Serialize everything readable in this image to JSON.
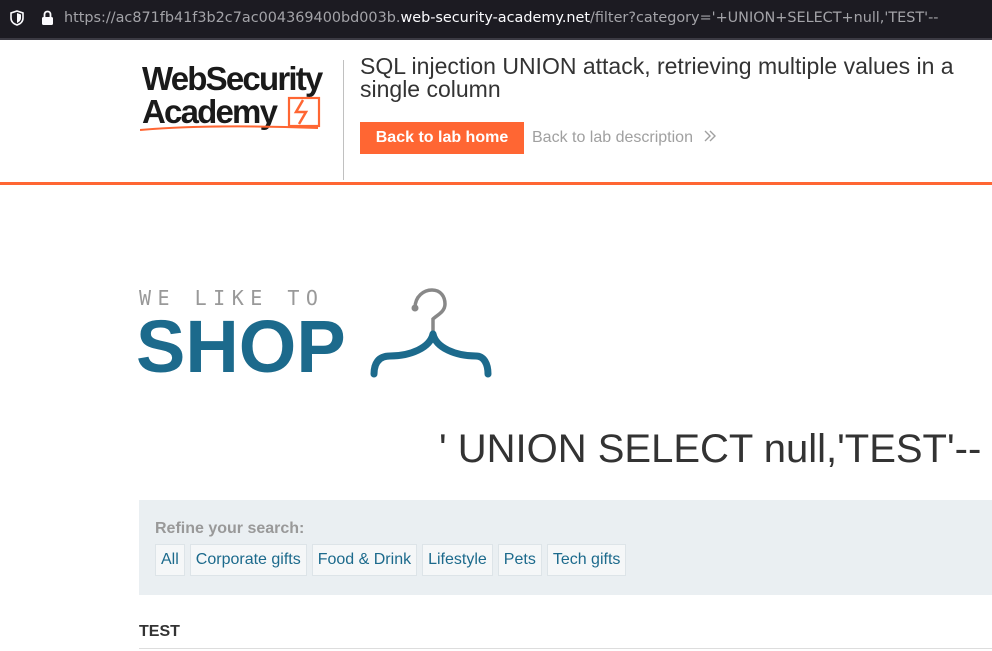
{
  "browser": {
    "url_prefix": "https://ac871fb41f3b2c7ac004369400bd003b.",
    "url_host": "web-security-academy.net",
    "url_path": "/filter?category='+UNION+SELECT+null,'TEST'--"
  },
  "lab_header": {
    "logo_line1": "WebSecurity",
    "logo_line2": "Academy",
    "title": "SQL injection UNION attack, retrieving multiple values in a single column",
    "back_home_label": "Back to lab home",
    "back_description_label": "Back to lab description"
  },
  "shop": {
    "tagline": "WE LIKE TO",
    "name": "SHOP"
  },
  "search": {
    "heading": "' UNION SELECT null,'TEST'--"
  },
  "filters": {
    "label": "Refine your search:",
    "categories": [
      "All",
      "Corporate gifts",
      "Food & Drink",
      "Lifestyle",
      "Pets",
      "Tech gifts"
    ]
  },
  "results": {
    "items": [
      "TEST"
    ]
  },
  "colors": {
    "accent": "#ff6633",
    "brand_blue": "#1c6a8c"
  }
}
